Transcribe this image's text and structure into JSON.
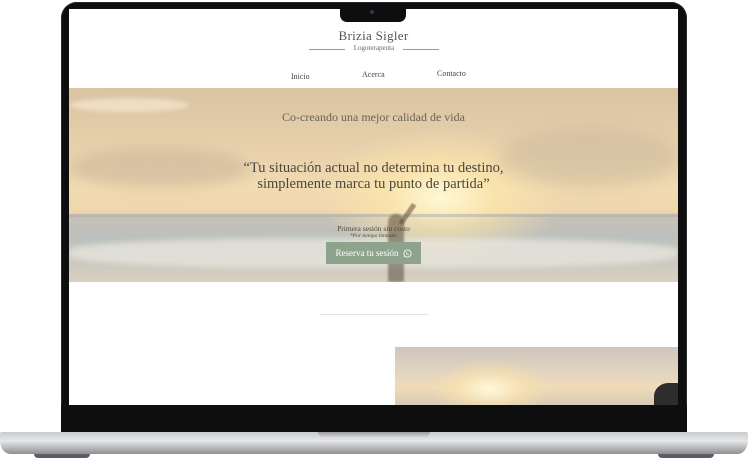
{
  "site": {
    "brand_name": "Brizia Sigler",
    "brand_subtitle": "Logoterapeuta"
  },
  "nav": {
    "items": [
      {
        "label": "Inicio"
      },
      {
        "label": "Acerca"
      },
      {
        "label": "Contacto"
      }
    ]
  },
  "hero": {
    "tagline": "Co-creando una mejor calidad de vida",
    "quote_line1": "“Tu situación actual no determina tu destino,",
    "quote_line2": "simplemente marca tu punto de partida”",
    "session_text": "Primera sesión sin costo",
    "session_note": "*Por tiempo limitado",
    "cta_label": "Reserva tu sesión",
    "cta_icon": "whatsapp-icon",
    "cta_color": "#8ea38c"
  }
}
